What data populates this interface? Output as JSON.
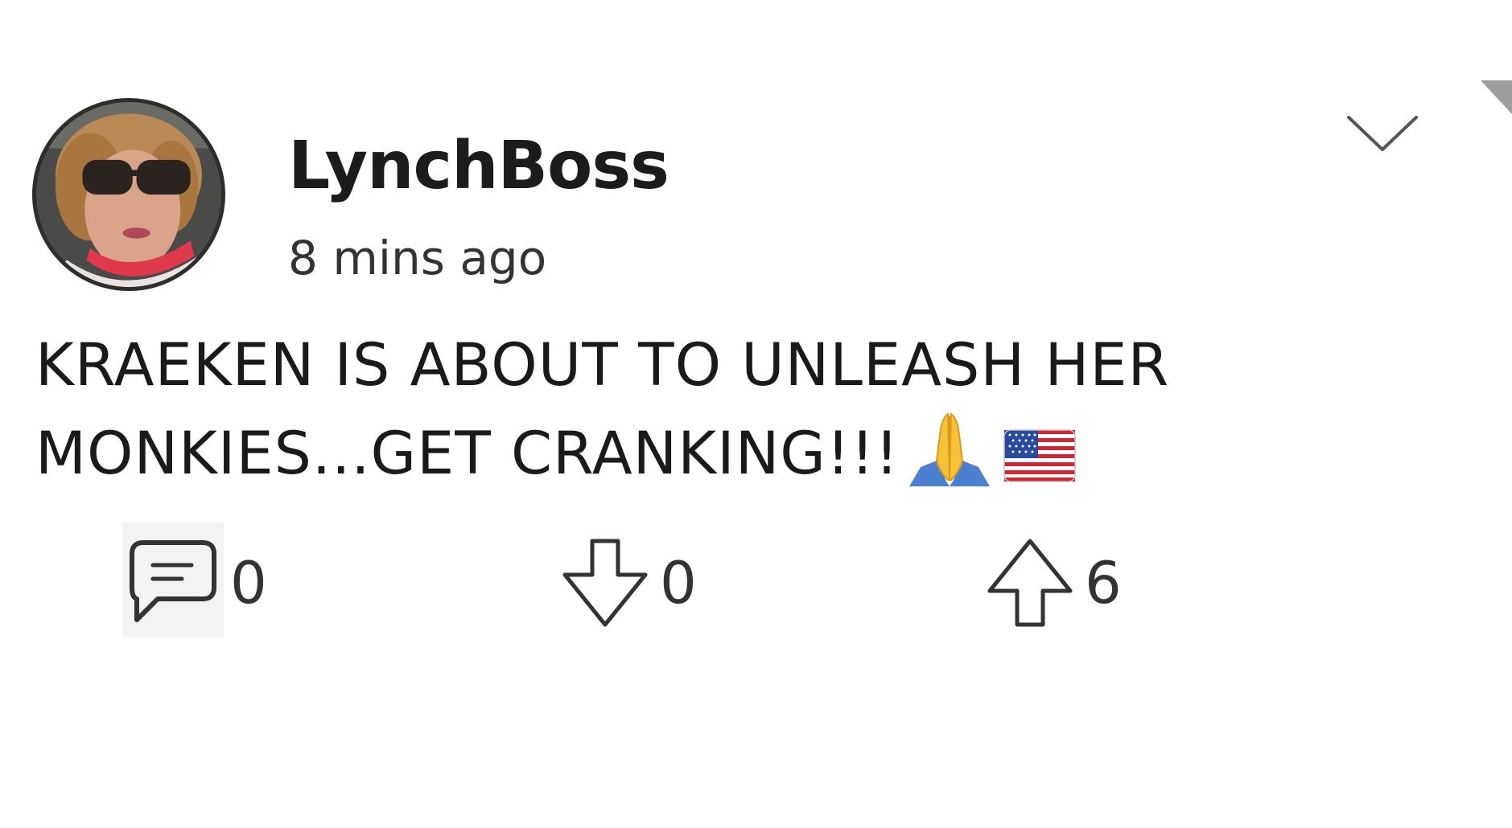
{
  "post": {
    "username": "LynchBoss",
    "timestamp": "8 mins ago",
    "avatar_icon": "user-avatar-photo",
    "menu_icon": "chevron-down-icon",
    "body_text": "KRAEKEN IS ABOUT TO UNLEASH HER MONKIES...GET CRANKING!!!",
    "emojis": [
      "folded-hands-emoji",
      "us-flag-emoji"
    ]
  },
  "actions": {
    "comments": {
      "icon": "comment-icon",
      "count": "0"
    },
    "downvotes": {
      "icon": "arrow-down-icon",
      "count": "0"
    },
    "upvotes": {
      "icon": "arrow-up-icon",
      "count": "6"
    }
  },
  "colors": {
    "background": "#ffffff",
    "text": "#1a1a1a",
    "icon_stroke": "#333333"
  }
}
